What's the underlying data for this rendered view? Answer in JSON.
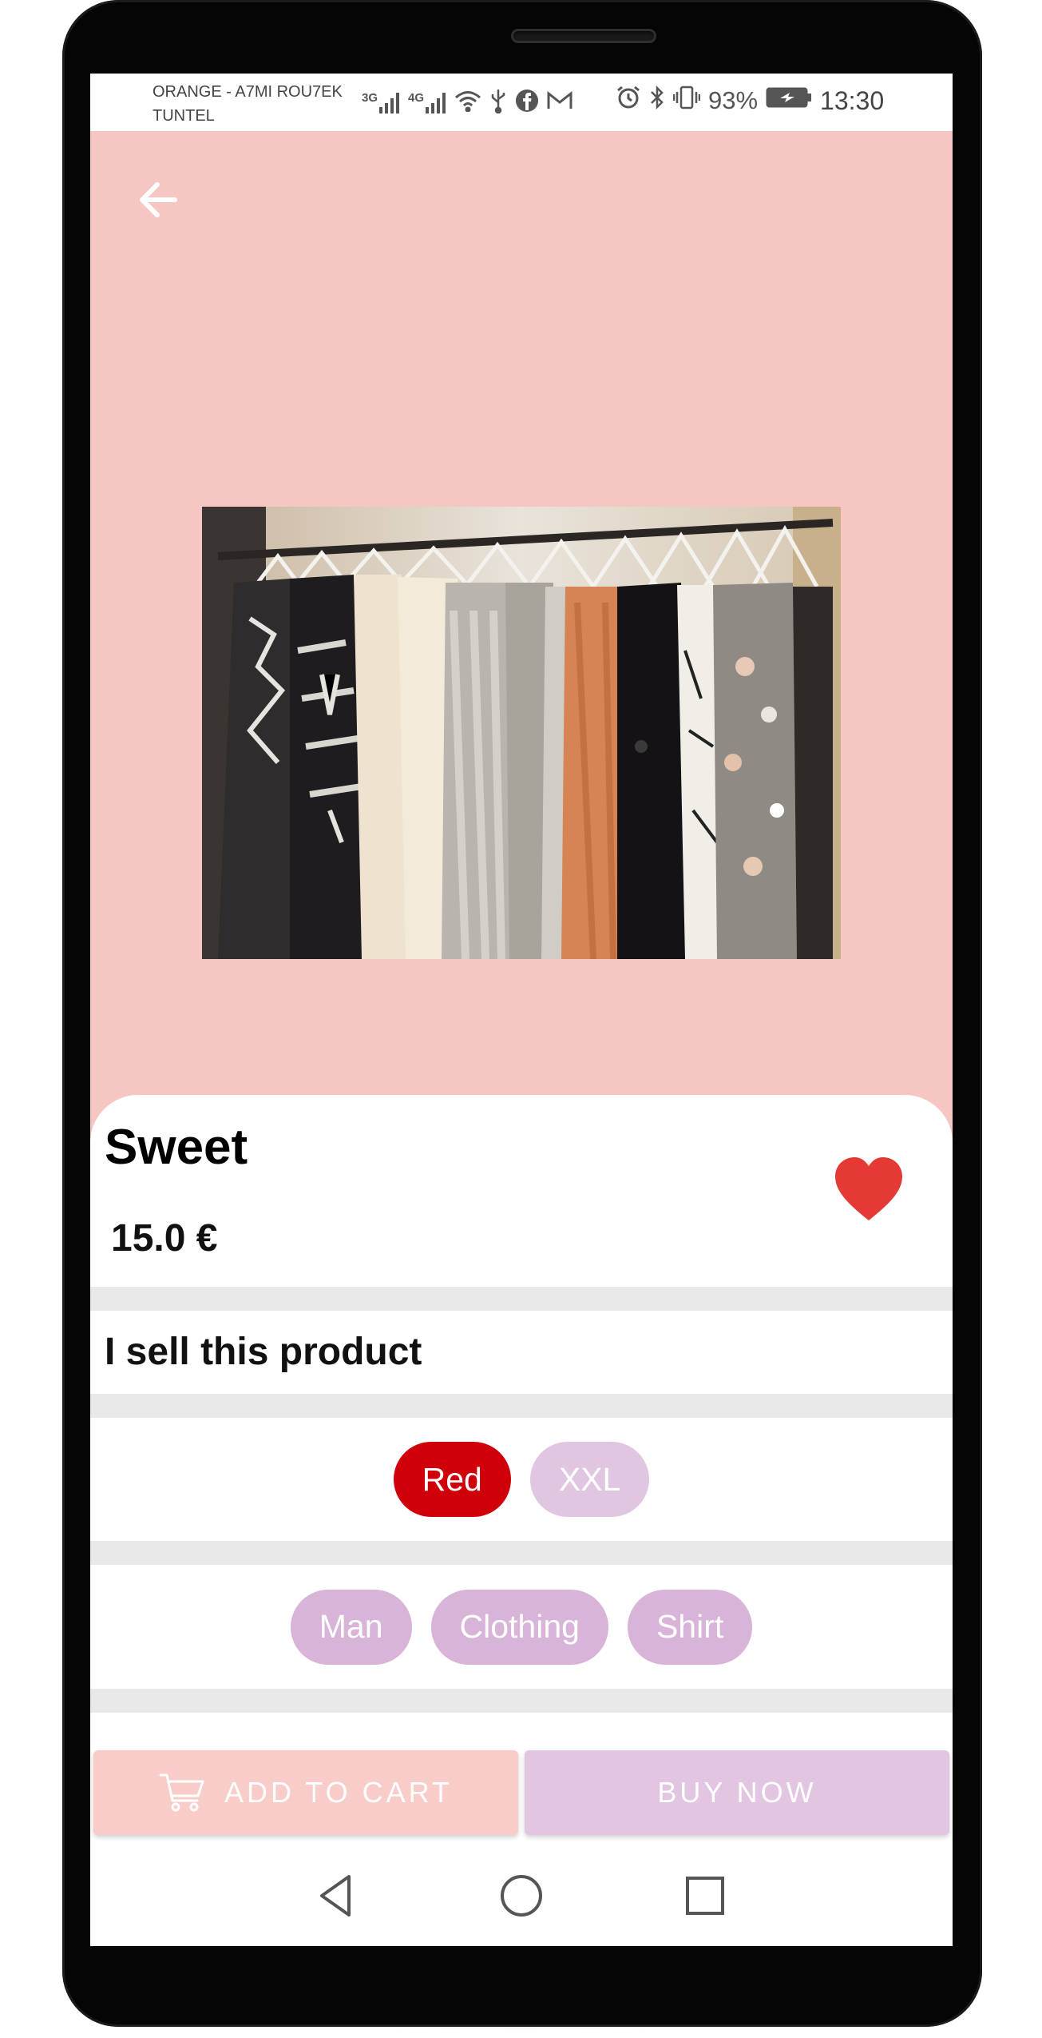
{
  "status_bar": {
    "carrier_line1": "ORANGE - A7MI ROU7EK",
    "carrier_line2": "TUNTEL",
    "network1": "3G",
    "network2": "4G",
    "battery": "93%",
    "time": "13:30"
  },
  "hero": {
    "background": "#f6c6c3",
    "image_description_icon": "clothing-rack-photo",
    "page_indicator_count": 1
  },
  "product": {
    "title": "Sweet",
    "price": "15.0 €",
    "favorite": true,
    "description": "I sell this product"
  },
  "attributes": [
    {
      "label": "Red",
      "color": "#d0000a"
    },
    {
      "label": "XXL",
      "color": "#e0c6e1"
    }
  ],
  "categories": [
    {
      "label": "Man"
    },
    {
      "label": "Clothing"
    },
    {
      "label": "Shirt"
    }
  ],
  "actions": {
    "add_to_cart": "ADD TO CART",
    "buy_now": "BUY NOW"
  },
  "colors": {
    "accent_red": "#e53935",
    "cart_button": "#f8ccc8",
    "buy_button": "#e1c5e1",
    "tag_purple": "#d8b4d9"
  }
}
